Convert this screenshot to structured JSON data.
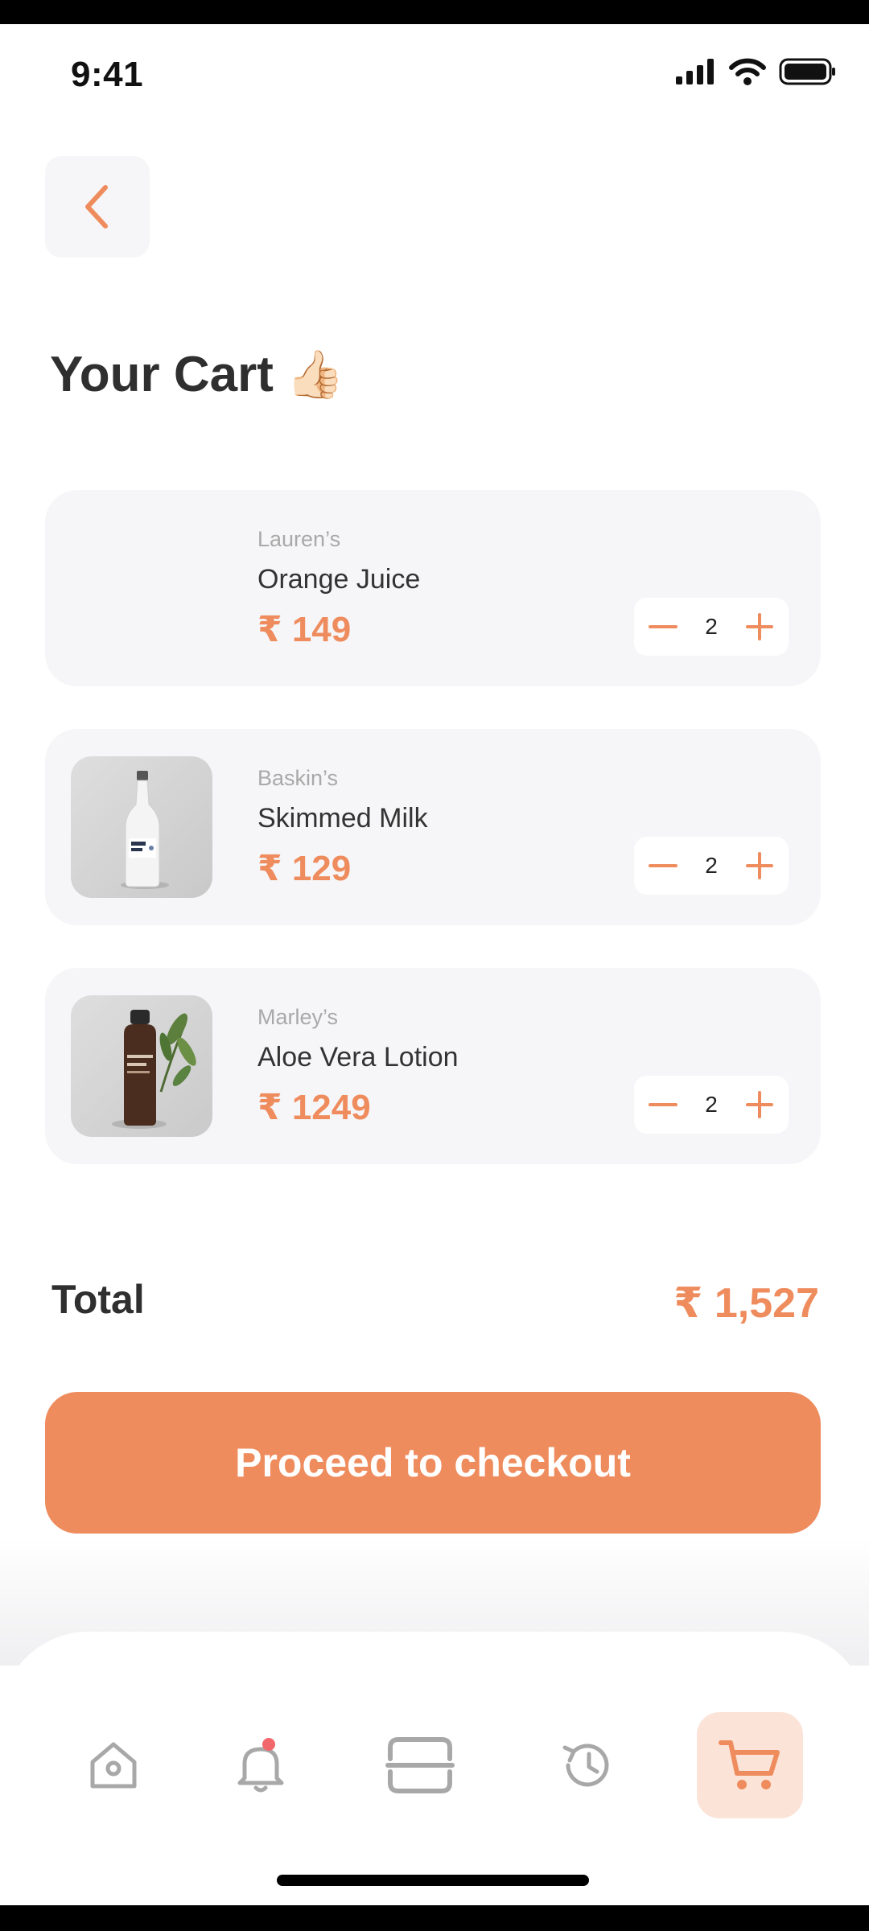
{
  "status_bar": {
    "time": "9:41"
  },
  "header": {
    "title": "Your Cart",
    "title_emoji": "👍🏻"
  },
  "cart": {
    "items": [
      {
        "brand": "Lauren’s",
        "name": "Orange Juice",
        "price": "₹ 149",
        "quantity": "2"
      },
      {
        "brand": "Baskin’s",
        "name": "Skimmed Milk",
        "price": "₹ 129",
        "quantity": "2"
      },
      {
        "brand": "Marley’s",
        "name": "Aloe Vera Lotion",
        "price": "₹ 1249",
        "quantity": "2"
      }
    ]
  },
  "summary": {
    "total_label": "Total",
    "total_value": "₹ 1,527"
  },
  "checkout": {
    "label": "Proceed to checkout"
  },
  "bottom_nav": {
    "items": [
      {
        "icon": "home-icon",
        "active": false
      },
      {
        "icon": "bell-icon",
        "active": false
      },
      {
        "icon": "scan-icon",
        "active": false
      },
      {
        "icon": "history-icon",
        "active": false
      },
      {
        "icon": "cart-icon",
        "active": true
      }
    ]
  },
  "colors": {
    "accent": "#ef8c5e",
    "card_bg": "#f6f6f8",
    "active_nav_bg": "#fbe3d8",
    "notification_dot": "#f2676b"
  }
}
